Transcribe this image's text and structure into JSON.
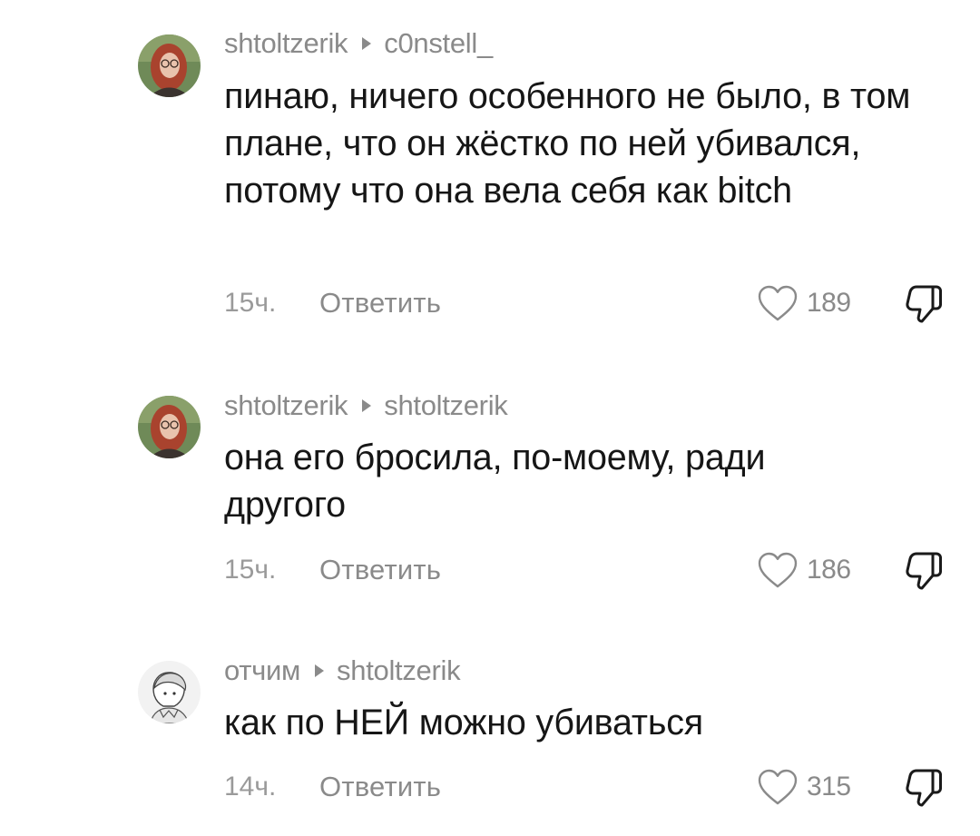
{
  "comments": [
    {
      "author": "shtoltzerik",
      "reply_to": "c0nstell_",
      "text": "пинаю, ничего особенного не было, в том плане, что он жёстко по ней убивался, потому что она вела себя как bitch",
      "time": "15ч.",
      "reply_label": "Ответить",
      "likes": "189",
      "avatar_icon": "avatar-redhead-glasses"
    },
    {
      "author": "shtoltzerik",
      "reply_to": "shtoltzerik",
      "text": "она его бросила, по-моему, ради другого",
      "time": "15ч.",
      "reply_label": "Ответить",
      "likes": "186",
      "avatar_icon": "avatar-redhead-glasses"
    },
    {
      "author": "отчим",
      "reply_to": "shtoltzerik",
      "text": "как по НЕЙ можно убиваться",
      "time": "14ч.",
      "reply_label": "Ответить",
      "likes": "315",
      "avatar_icon": "avatar-manga-sketch"
    }
  ],
  "icons": {
    "like": "heart-outline-icon",
    "dislike": "thumbs-down-outline-icon"
  },
  "colors": {
    "text": "#161616",
    "muted": "#8a8a8a",
    "background": "#ffffff"
  }
}
